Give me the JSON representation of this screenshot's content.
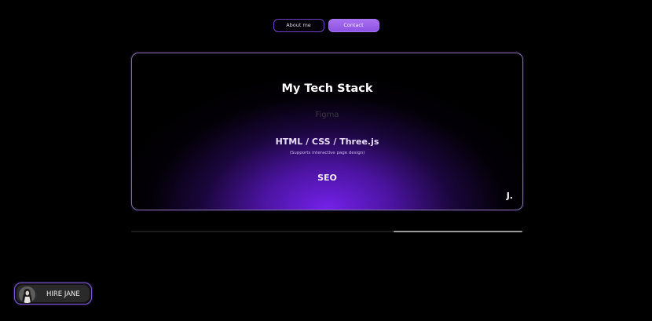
{
  "nav": {
    "about_label": "About me",
    "contact_label": "Contact"
  },
  "card": {
    "title": "My Tech Stack",
    "items": [
      {
        "label": "Figma",
        "note": ""
      },
      {
        "label": "HTML / CSS / Three.js",
        "note": "(Supports interactive page design)"
      },
      {
        "label": "SEO",
        "note": ""
      }
    ],
    "logo": "J."
  },
  "carousel": {
    "progress_start": 0.67,
    "progress_end": 1.0
  },
  "hire": {
    "label": "HIRE JANE"
  },
  "colors": {
    "background": "#000000",
    "accent_purple": "#7e24ff",
    "contact_button": "#a86ff0"
  }
}
